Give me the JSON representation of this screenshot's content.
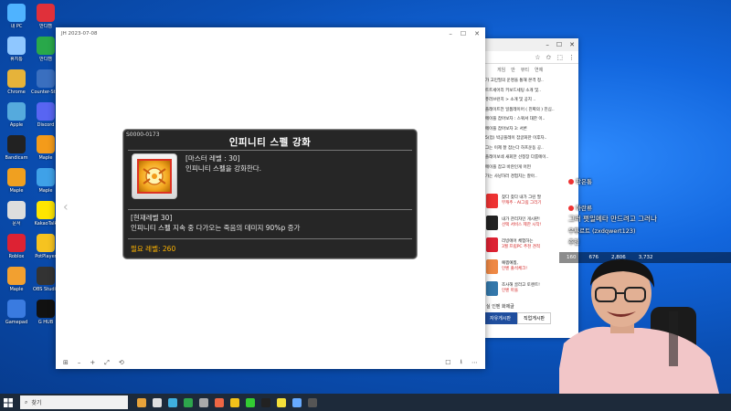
{
  "desktop": {
    "icons": [
      {
        "label": "내 PC",
        "icon": "pc-icon",
        "color": "#4fb3ff"
      },
      {
        "label": "반디캠",
        "icon": "bandicam-icon",
        "color": "#e0303a"
      },
      {
        "label": "휴지통",
        "icon": "recycle-bin-icon",
        "color": "#8fc7ff"
      },
      {
        "label": "반디캠",
        "icon": "bandicut-icon",
        "color": "#29a84a"
      },
      {
        "label": "Chrome",
        "icon": "chrome-icon",
        "color": "#e6b33a"
      },
      {
        "label": "Counter-Strike",
        "icon": "cs-icon",
        "color": "#3a6fbf"
      },
      {
        "label": "Apple",
        "icon": "apple-icon",
        "color": "#5ad"
      },
      {
        "label": "Discord",
        "icon": "discord-icon",
        "color": "#5865f2"
      },
      {
        "label": "Bandicam",
        "icon": "bandicam-rec-icon",
        "color": "#222"
      },
      {
        "label": "Maple",
        "icon": "maple-icon",
        "color": "#f49b1a"
      },
      {
        "label": "Maple",
        "icon": "maple-world-icon",
        "color": "#f0a020"
      },
      {
        "label": "Maple",
        "icon": "maple-m-icon",
        "color": "#3fa1e8"
      },
      {
        "label": "문서",
        "icon": "file-icon",
        "color": "#ddd"
      },
      {
        "label": "KakaoTalk",
        "icon": "kakaotalk-icon",
        "color": "#fee500"
      },
      {
        "label": "Roblox",
        "icon": "roblox-icon",
        "color": "#d23"
      },
      {
        "label": "PotPlayer",
        "icon": "potplayer-icon",
        "color": "#f6c320"
      },
      {
        "label": "Maple",
        "icon": "maple-story-icon",
        "color": "#f2a030"
      },
      {
        "label": "OBS Studio",
        "icon": "obs-icon",
        "color": "#333"
      },
      {
        "label": "Gamepad",
        "icon": "gamepad-icon",
        "color": "#3a7be0"
      },
      {
        "label": "G HUB",
        "icon": "ghub-icon",
        "color": "#111"
      }
    ]
  },
  "browser": {
    "titlebar": {
      "min": "–",
      "max": "☐",
      "close": "✕"
    },
    "toolbar": [
      "☆",
      "✩",
      "⬚",
      "⋮"
    ],
    "navtabs": [
      "게임",
      "만",
      "뷰티",
      "연예"
    ],
    "news": [
      "가 고민필의 운명을 통해 본격 정..",
      "트트세어리 키보드세팅 소개 및..",
      "퓨러브런치 > 소개 및 공지 ..",
      "플레이트전 일품레이어 ( 진짜의 ) 진심..",
      "메이플 잡아보자 : 스쿼셔 대한 이..",
      "메이플 잡아보자 3: 서론",
      "5(업) 박공플레이 잡글화한 이후자..",
      "그는 이제 잘 잡는다 하프운동 공..",
      "플레이보네 새회한 선정장 다룸에이..",
      "메이플 잡고 바란인게 어떤",
      "가는 사냥하러 경험치는 잘아.."
    ],
    "ads": [
      {
        "t1": "찾다 찾다 내가 그린 팔",
        "t2": "부캐추 - AI그림 그리기",
        "color": "#e33"
      },
      {
        "t1": "내가 관리자인 게시판!",
        "t2": "선택 서비스 제한 시작!",
        "color": "#222"
      },
      {
        "t1": "리빙에어 체험하는",
        "t2": "3월 프립PC 추천 견적",
        "color": "#d23"
      },
      {
        "t1": "예찜예찜,",
        "t2": "인벤 출석체크!",
        "color": "#e84"
      },
      {
        "t1": "조사해 골라고 토렌트!",
        "t2": "인벤 마을",
        "color": "#37a"
      }
    ],
    "hot_label": "실 인벤 화제글",
    "board_tabs": [
      "자유게시판",
      "직업게시판"
    ]
  },
  "viewer": {
    "title": "JH 2023-07-08",
    "controls": {
      "min": "–",
      "max": "☐",
      "close": "✕"
    },
    "bottom_left": [
      "⊞",
      "–",
      "+",
      "⤢",
      "⟲"
    ],
    "bottom_right": [
      "☐",
      "⭳",
      "⋯"
    ]
  },
  "tooltip": {
    "skill_id": "S0000-0173",
    "name": "인피니티 스펠 강화",
    "master_level": "[마스터 레벨 : 30]",
    "description": "인피니티 스펠을 강화한다.",
    "current_level": "[현재레벨 30]",
    "current_effect": "인피니티 스펠 지속 중 다가오는 죽음의 데미지 90%p 증가",
    "required_level": "필요 레벨: 260",
    "colors": {
      "bg": "#262626",
      "required": "#ffb400"
    }
  },
  "stream": {
    "chat": [
      {
        "user": "작은통",
        "text": ""
      },
      {
        "user": "아란류",
        "text": ""
      },
      {
        "user": "",
        "text": "그러 펫일메타 만드려고 그러나"
      },
      {
        "user": "",
        "text": "우투르트 (zxdqwert123)"
      },
      {
        "user": "",
        "text": "추천"
      }
    ],
    "stats": [
      "160",
      "676",
      "2,806",
      "3,732"
    ]
  },
  "taskbar": {
    "search_placeholder": "찾기",
    "apps": [
      "#e8a33a",
      "#e0e0e0",
      "#3fb0e0",
      "#2da64c",
      "#aaa",
      "#e64",
      "#f2c21a",
      "#3c3",
      "#222",
      "#f4e03a",
      "#6af",
      "#555"
    ]
  }
}
